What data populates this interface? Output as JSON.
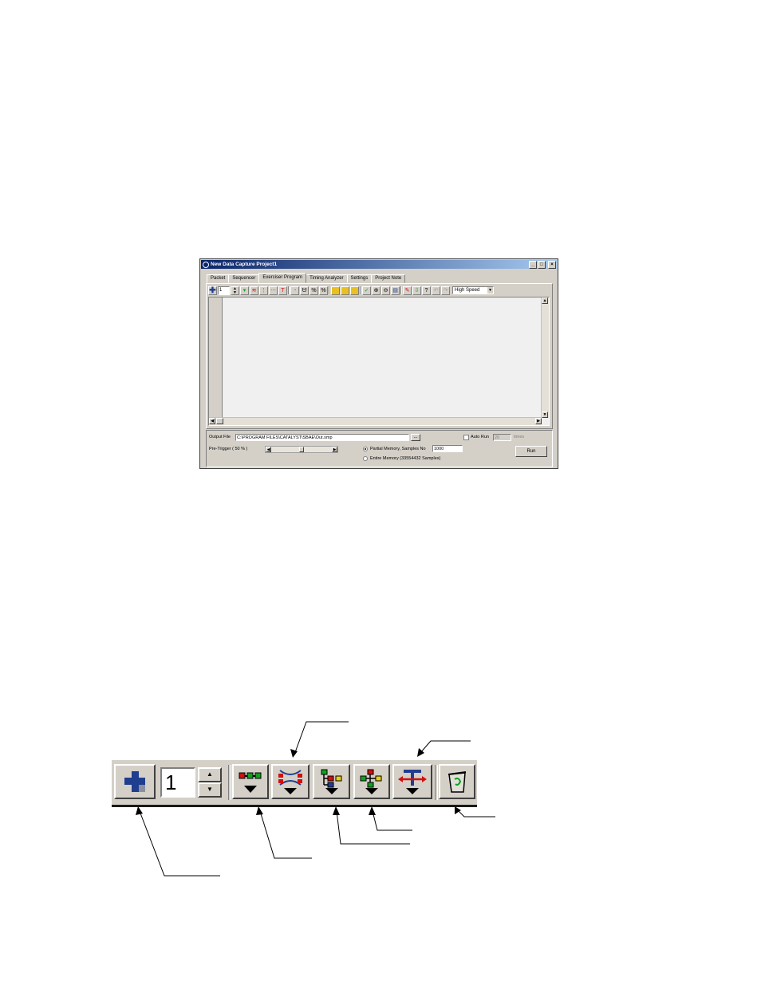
{
  "window": {
    "title": "New Data Capture Project1",
    "controls": [
      "_",
      "□",
      "×"
    ],
    "tabs": [
      "Packet",
      "Sequencer",
      "Exerciser Program",
      "Timing Analyzer",
      "Settings",
      "Project Note"
    ],
    "active_tab": "Exerciser Program",
    "toolbar": {
      "count_value": "1",
      "speed_value": "High Speed"
    },
    "bottom": {
      "output_file_label": "Output File",
      "output_file_value": "C:\\PROGRAM FILES\\CATALYST\\SBAE\\Out.smp",
      "browse_label": "...",
      "pre_trigger_label": "Pre-Trigger ( 50 % )",
      "pre_trigger_percent": 50,
      "auto_run_label": "Auto Run",
      "auto_run_value": "20",
      "auto_run_unit": "times",
      "partial_memory_label": "Partial Memory, Samples No",
      "samples_value": "1000",
      "entire_memory_label": "Entire Memory (33554432 Samples)",
      "run_label": "Run"
    }
  },
  "zoom_toolbar": {
    "count_value": "1"
  },
  "icons": [
    "plus-icon",
    "insert-row-icon",
    "repeat-block-icon",
    "branch-icon",
    "nested-branch-icon",
    "timing-icon",
    "trash-icon"
  ],
  "colors": {
    "title_start": "#0a246a",
    "title_end": "#a6caf0",
    "face": "#d4d0c8",
    "plus_blue": "#1f3e8f",
    "red": "#d01010",
    "green": "#10a020",
    "yellow": "#e8d010"
  }
}
